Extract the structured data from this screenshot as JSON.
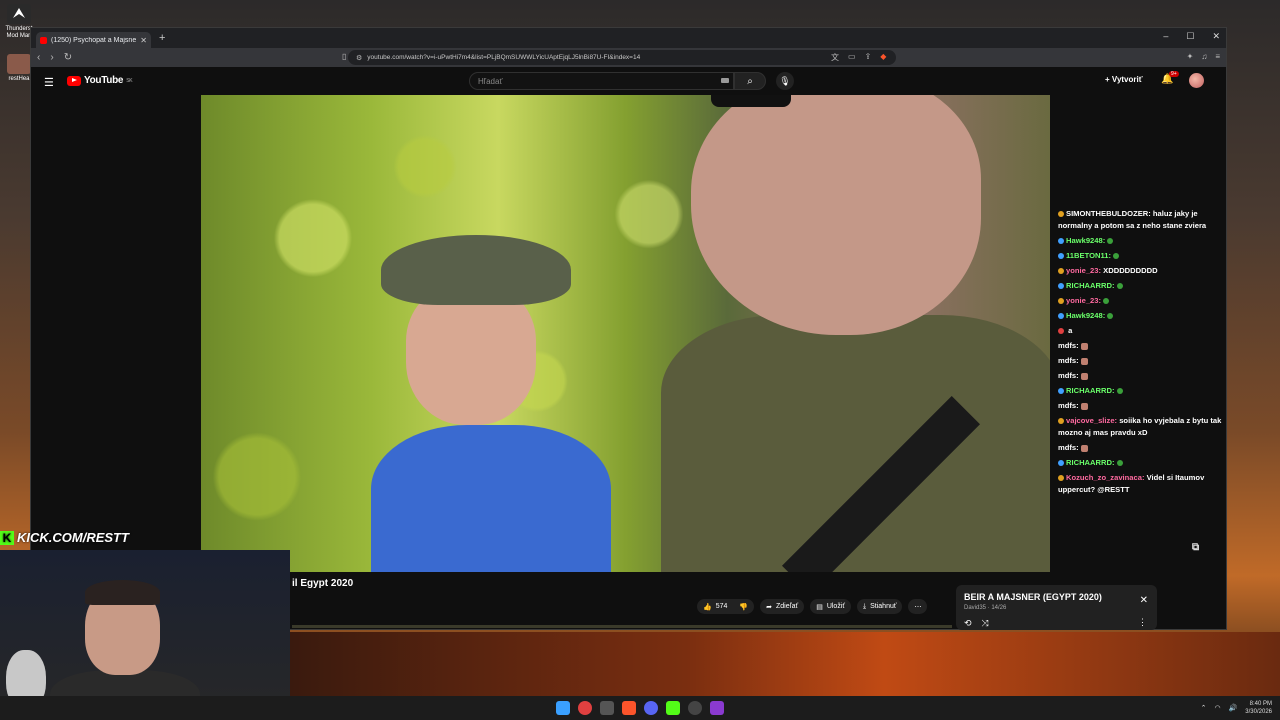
{
  "desktop": {
    "icons": [
      {
        "label": "Thunderst Mod Man"
      },
      {
        "label": "restHea"
      }
    ]
  },
  "browser": {
    "tab_title": "(1250) Psychopat a Majsner",
    "url": "youtube.com/watch?v=i-uPwtHi7m4&list=PLjBQmSUWWLYicUAptEjqLJ5lnBi87U-FI&index=14"
  },
  "youtube": {
    "logo": "YouTube",
    "logo_sup": "SK",
    "search_placeholder": "Hľadať",
    "create_label": "Vytvoriť",
    "bell_badge": "9+",
    "video_title": "il Egypt 2020",
    "actions": {
      "likes": "574",
      "share": "Zdieľať",
      "save": "Uložiť",
      "download": "Stiahnuť"
    },
    "playlist": {
      "title": "BEIR A MAJSNER (EGYPT 2020)",
      "subtitle": "David35 · 14/26"
    }
  },
  "chat": [
    {
      "user": "SIMONTHEBULDOZER:",
      "msg": "haluz jaky je normalny a potom sa z neho stane zviera",
      "color": "white"
    },
    {
      "user": "Hawk9248:",
      "msg": "",
      "color": "green"
    },
    {
      "user": "11BETON11:",
      "msg": "",
      "color": "green"
    },
    {
      "user": "yonie_23:",
      "msg": "XDDDDDDDDD",
      "color": "pink"
    },
    {
      "user": "RICHAARRD:",
      "msg": "",
      "color": "green"
    },
    {
      "user": "yonie_23:",
      "msg": "",
      "color": "pink"
    },
    {
      "user": "Hawk9248:",
      "msg": "",
      "color": "green"
    },
    {
      "user": "",
      "msg": "a",
      "color": "red"
    },
    {
      "user": "mdfs:",
      "msg": "",
      "color": "white"
    },
    {
      "user": "mdfs:",
      "msg": "",
      "color": "white"
    },
    {
      "user": "mdfs:",
      "msg": "",
      "color": "white"
    },
    {
      "user": "RICHAARRD:",
      "msg": "",
      "color": "green"
    },
    {
      "user": "mdfs:",
      "msg": "",
      "color": "white"
    },
    {
      "user": "vajcove_slize:",
      "msg": "soiika ho vyjebala z bytu tak mozno aj mas pravdu xD",
      "color": "pink"
    },
    {
      "user": "mdfs:",
      "msg": "",
      "color": "white"
    },
    {
      "user": "RICHAARRD:",
      "msg": "",
      "color": "green"
    },
    {
      "user": "Kozuch_zo_zavinaca:",
      "msg": "Videl si Itaumov uppercut? @RESTT",
      "color": "pink"
    }
  ],
  "stream": {
    "kick_url": "KICK.COM/RESTT"
  },
  "taskbar": {
    "time": "8:40 PM",
    "date": "3/30/2026"
  },
  "colors": {
    "youtube_red": "#ff0000",
    "kick_green": "#53fc18"
  }
}
